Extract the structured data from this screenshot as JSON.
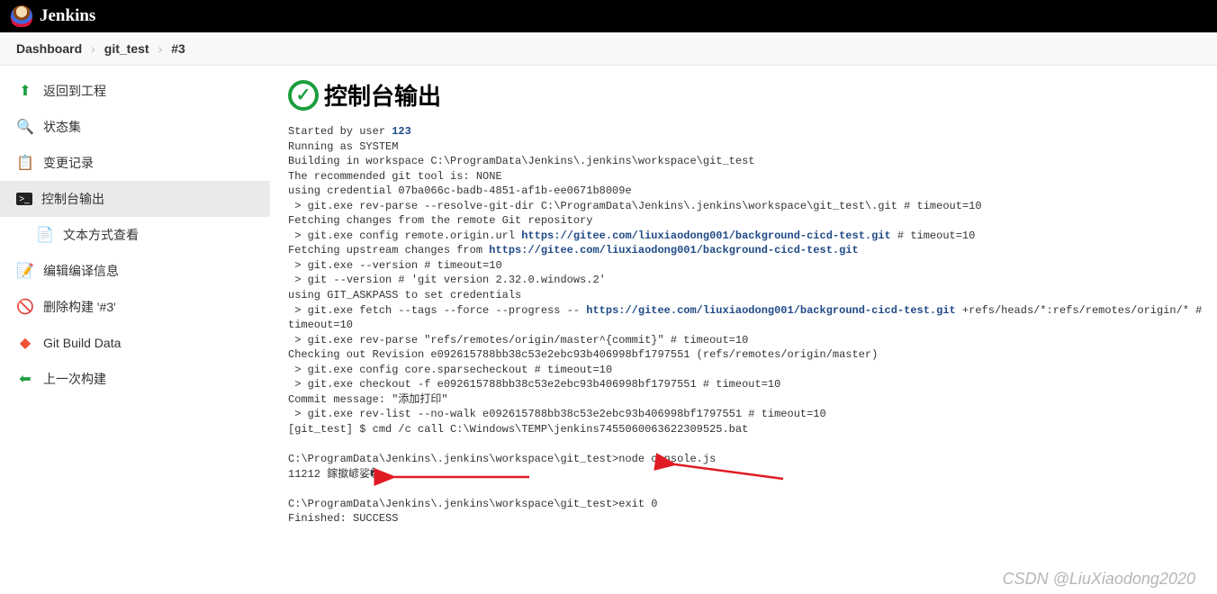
{
  "header": {
    "product": "Jenkins"
  },
  "breadcrumbs": [
    {
      "label": "Dashboard"
    },
    {
      "label": "git_test"
    },
    {
      "label": "#3"
    }
  ],
  "sidebar": [
    {
      "icon": "arrow-up-green",
      "label": "返回到工程"
    },
    {
      "icon": "magnifier",
      "label": "状态集"
    },
    {
      "icon": "notepad",
      "label": "变更记录"
    },
    {
      "icon": "terminal",
      "label": "控制台输出",
      "selected": true
    },
    {
      "icon": "document",
      "label": "文本方式查看",
      "sub": true
    },
    {
      "icon": "edit-doc",
      "label": "编辑编译信息"
    },
    {
      "icon": "no-entry",
      "label": "删除构建 '#3'"
    },
    {
      "icon": "git",
      "label": "Git Build Data"
    },
    {
      "icon": "arrow-left-green",
      "label": "上一次构建"
    }
  ],
  "page": {
    "title": "控制台输出"
  },
  "console": {
    "started_by_prefix": "Started by user ",
    "started_by_user": "123",
    "lines1": "Running as SYSTEM\nBuilding in workspace C:\\ProgramData\\Jenkins\\.jenkins\\workspace\\git_test\nThe recommended git tool is: NONE\nusing credential 07ba066c-badb-4851-af1b-ee0671b8009e\n > git.exe rev-parse --resolve-git-dir C:\\ProgramData\\Jenkins\\.jenkins\\workspace\\git_test\\.git # timeout=10\nFetching changes from the remote Git repository\n > git.exe config remote.origin.url ",
    "url1": "https://gitee.com/liuxiaodong001/background-cicd-test.git",
    "after_url1": " # timeout=10\nFetching upstream changes from ",
    "url2": "https://gitee.com/liuxiaodong001/background-cicd-test.git",
    "lines2": "\n > git.exe --version # timeout=10\n > git --version # 'git version 2.32.0.windows.2'\nusing GIT_ASKPASS to set credentials \n > git.exe fetch --tags --force --progress -- ",
    "url3": "https://gitee.com/liuxiaodong001/background-cicd-test.git",
    "lines3": " +refs/heads/*:refs/remotes/origin/* # timeout=10\n > git.exe rev-parse \"refs/remotes/origin/master^{commit}\" # timeout=10\nChecking out Revision e092615788bb38c53e2ebc93b406998bf1797551 (refs/remotes/origin/master)\n > git.exe config core.sparsecheckout # timeout=10\n > git.exe checkout -f e092615788bb38c53e2ebc93b406998bf1797551 # timeout=10\nCommit message: \"添加打印\"\n > git.exe rev-list --no-walk e092615788bb38c53e2ebc93b406998bf1797551 # timeout=10\n[git_test] $ cmd /c call C:\\Windows\\TEMP\\jenkins7455060063622309525.bat\n\nC:\\ProgramData\\Jenkins\\.jenkins\\workspace\\git_test>node console.js\n11212 鎵撳嵃娑�\n\nC:\\ProgramData\\Jenkins\\.jenkins\\workspace\\git_test>exit 0\nFinished: SUCCESS"
  },
  "watermark": "CSDN @LiuXiaodong2020"
}
